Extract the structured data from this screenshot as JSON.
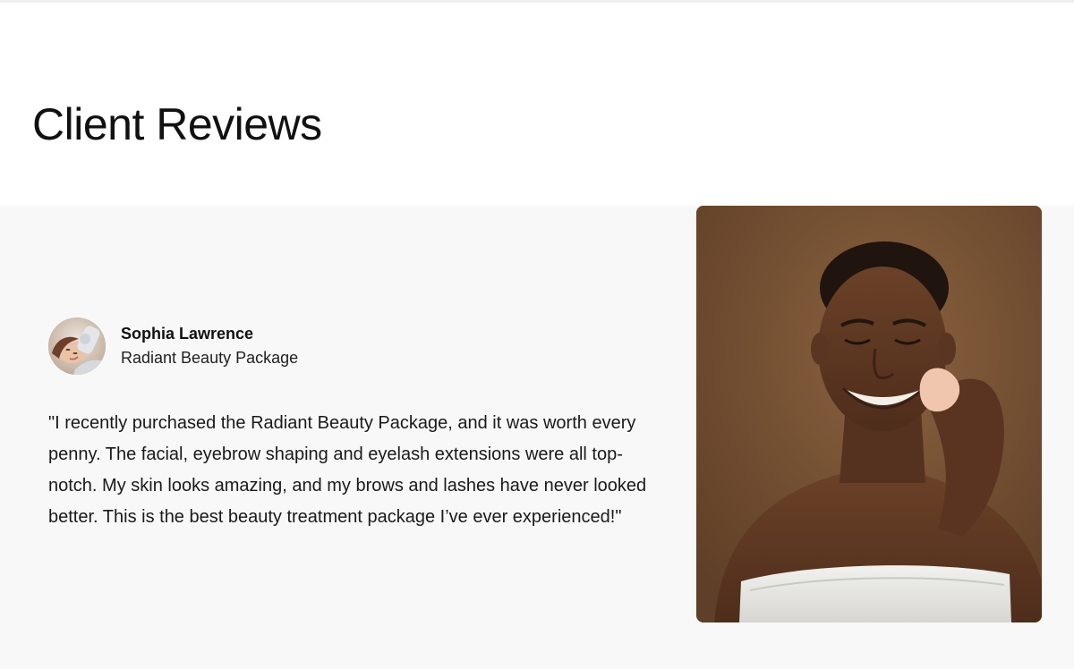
{
  "page": {
    "title": "Client Reviews"
  },
  "review": {
    "author_name": "Sophia Lawrence",
    "package_name": "Radiant Beauty Package",
    "text": "\"I recently purchased the Radiant Beauty Package, and it was worth every penny. The facial, eyebrow shaping and eyelash extensions were all top-notch. My skin looks amazing, and my brows and lashes have never looked better. This is the best beauty treatment package I’ve ever experienced!\"",
    "avatar_icon": "client-avatar-photo",
    "photo_icon": "smiling-woman-with-beauty-sponge-photo"
  },
  "colors": {
    "section_background": "#f8f8f8",
    "photo_background": "#7a5438",
    "text": "#111111"
  }
}
